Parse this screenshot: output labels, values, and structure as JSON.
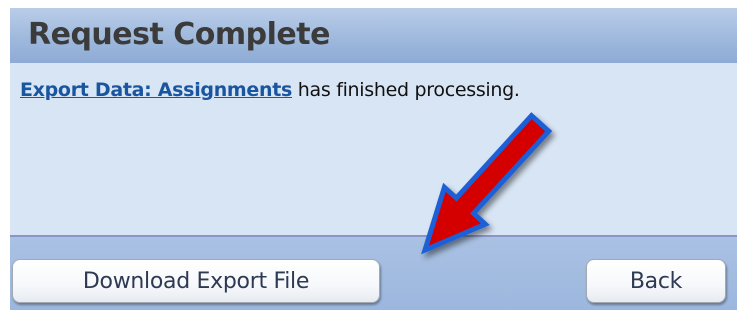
{
  "dialog": {
    "title": "Request Complete",
    "message": {
      "link_text": "Export Data: Assignments",
      "suffix_text": " has finished processing."
    }
  },
  "buttons": {
    "download_label": "Download Export File",
    "back_label": "Back"
  },
  "annotation": {
    "icon": "red-arrow-icon",
    "fill_color": "#d40000",
    "outline_color": "#1f5fd6"
  },
  "colors": {
    "header_bg": "#9fb9dd",
    "content_bg": "#d8e5f5",
    "footer_bg": "#a9c1e3",
    "link": "#1a56a0"
  }
}
